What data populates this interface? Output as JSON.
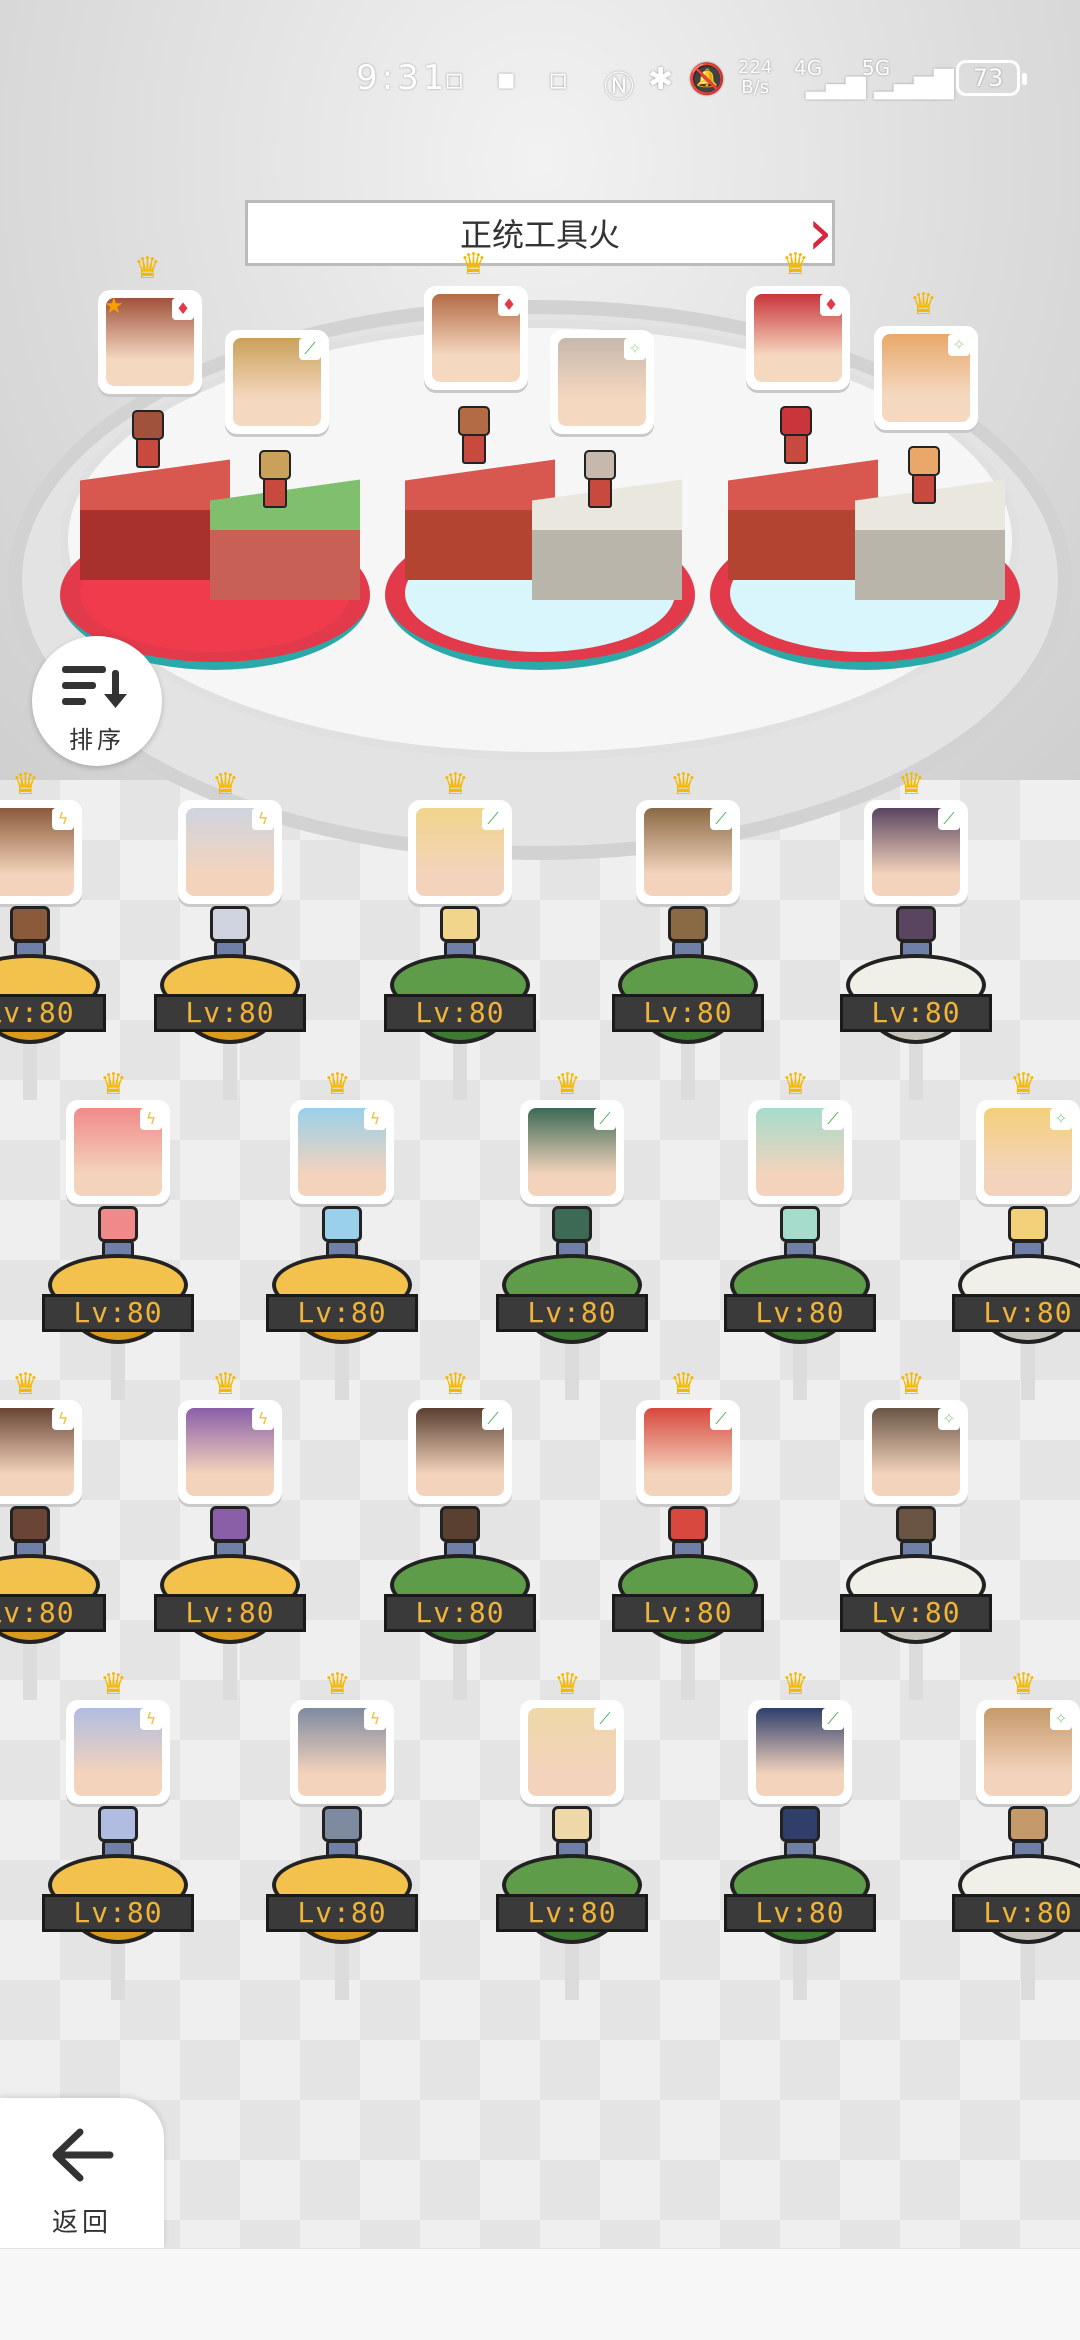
{
  "status_bar": {
    "time": "9:31",
    "net_speed_value": "224",
    "net_speed_unit": "B/s",
    "network_4g": "4G",
    "network_5g": "5G",
    "battery": "73"
  },
  "header": {
    "title": "正统工具火"
  },
  "team": [
    {
      "element": "fire",
      "element_color": "#e23a4a",
      "has_star": true,
      "crown": true,
      "face_color": "#a0523c"
    },
    {
      "element": "nature",
      "element_color": "#3fae46",
      "has_star": false,
      "crown": false,
      "face_color": "#c9a15a"
    },
    {
      "element": "fire",
      "element_color": "#e23a4a",
      "has_star": false,
      "crown": true,
      "face_color": "#b36b45"
    },
    {
      "element": "light",
      "element_color": "#b5d8a0",
      "has_star": false,
      "crown": false,
      "face_color": "#c7b8ad"
    },
    {
      "element": "fire",
      "element_color": "#e23a4a",
      "has_star": false,
      "crown": true,
      "face_color": "#c9353a"
    },
    {
      "element": "light",
      "element_color": "#b5d8a0",
      "has_star": false,
      "crown": true,
      "face_color": "#e9a86a"
    }
  ],
  "sort_button": {
    "label": "排序"
  },
  "back_button": {
    "label": "返回"
  },
  "roster": {
    "level_label": "Lv:80",
    "level_label_cut": "80",
    "rows": [
      [
        {
          "element": "electric",
          "color": "gold",
          "face": "#8a5a3a"
        },
        {
          "element": "electric",
          "color": "gold",
          "face": "#cfd4e0"
        },
        {
          "element": "nature",
          "color": "green",
          "face": "#f0d58a"
        },
        {
          "element": "nature",
          "color": "green",
          "face": "#8a6a45"
        },
        {
          "element": "nature",
          "color": "white",
          "face": "#5a4560"
        }
      ],
      [
        {
          "element": "electric",
          "color": "gold",
          "face": "#f08a8a"
        },
        {
          "element": "electric",
          "color": "gold",
          "face": "#9ad0ea"
        },
        {
          "element": "nature",
          "color": "green",
          "face": "#3d6a55"
        },
        {
          "element": "nature",
          "color": "green",
          "face": "#a6dccc"
        },
        {
          "element": "light",
          "color": "white",
          "face": "#f3d07a"
        }
      ],
      [
        {
          "element": "electric",
          "color": "gold",
          "face": "#6a4535"
        },
        {
          "element": "electric",
          "color": "gold",
          "face": "#8a5fa8"
        },
        {
          "element": "nature",
          "color": "green",
          "face": "#5a4030"
        },
        {
          "element": "nature",
          "color": "green",
          "face": "#d8483e"
        },
        {
          "element": "light",
          "color": "white",
          "face": "#6a5545"
        }
      ],
      [
        {
          "element": "electric",
          "color": "gold",
          "face": "#b0bde0"
        },
        {
          "element": "electric",
          "color": "gold",
          "face": "#7e8aa0"
        },
        {
          "element": "nature",
          "color": "green",
          "face": "#eed8a8"
        },
        {
          "element": "nature",
          "color": "green",
          "face": "#2f3f6a"
        },
        {
          "element": "light",
          "color": "white",
          "face": "#c49a6a"
        }
      ]
    ]
  },
  "colors": {
    "fire": "#e23a4a",
    "electric": "#f2c233",
    "nature": "#3fae46",
    "light": "#9fd39a",
    "crown": "#f5b800",
    "level_text": "#f0b33a"
  }
}
